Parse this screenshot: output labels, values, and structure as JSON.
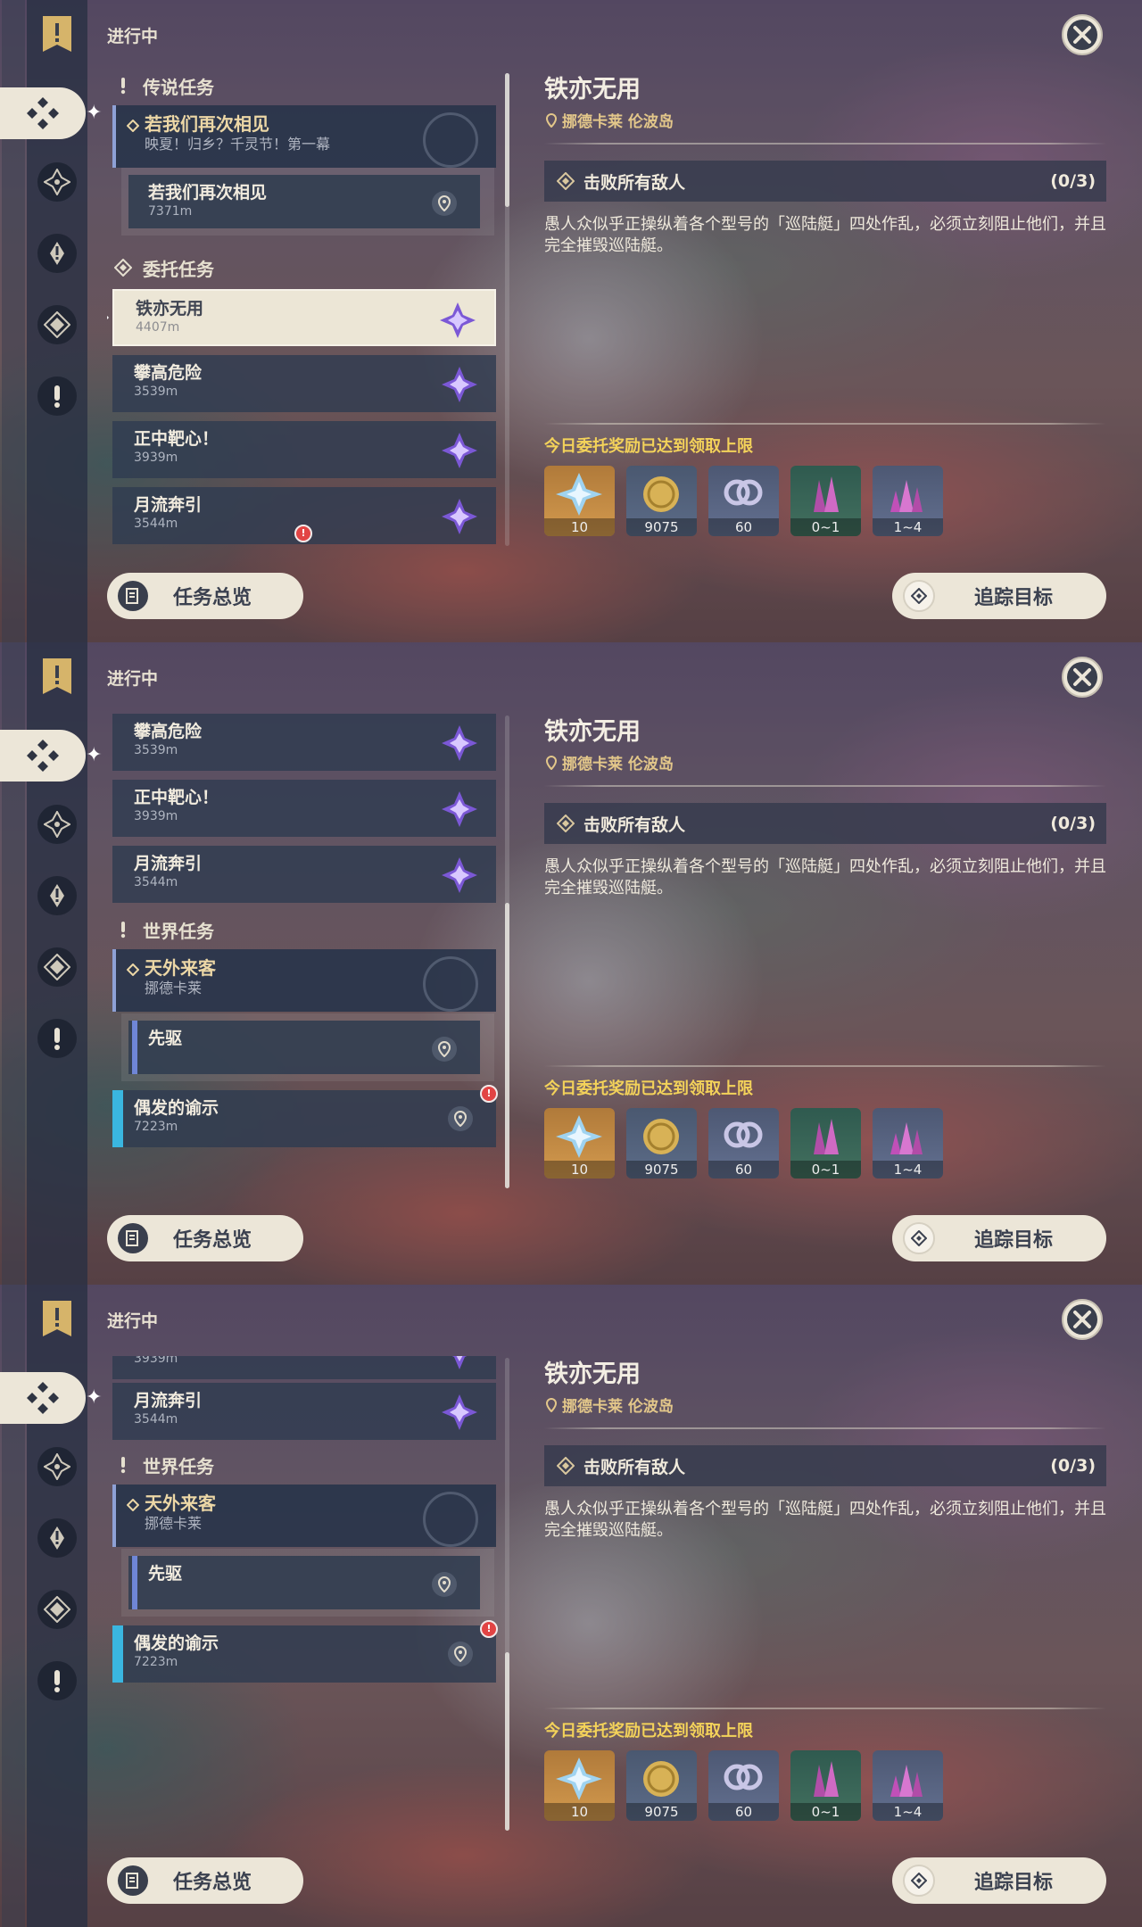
{
  "header": {
    "in_progress": "进行中"
  },
  "sections": {
    "legend": "传说任务",
    "commission": "委托任务",
    "world": "世界任务"
  },
  "quests": {
    "legend_title": "若我们再次相见",
    "legend_sub": "映夏！归乡？千灵节！第一幕",
    "legend_step_title": "若我们再次相见",
    "legend_step_dist": "7371m",
    "c1_title": "铁亦无用",
    "c1_dist": "4407m",
    "c2_title": "攀高危险",
    "c2_dist": "3539m",
    "c3_title": "正中靶心！",
    "c3_dist": "3939m",
    "c4_title": "月流奔引",
    "c4_dist": "3544m",
    "world_title": "天外来客",
    "world_sub": "挪德卡莱",
    "world_step_title": "先驱",
    "event_title": "偶发的谕示",
    "event_dist": "7223m"
  },
  "detail": {
    "title": "铁亦无用",
    "location": "挪德卡莱 伦波岛",
    "objective": "击败所有敌人",
    "objective_count": "(0/3)",
    "description": "愚人众似乎正操纵着各个型号的「巡陆艇」四处作乱，必须立刻阻止他们，并且完全摧毁巡陆艇。",
    "reward_limit": "今日委托奖励已达到领取上限",
    "rewards": [
      {
        "icon": "primogem-icon",
        "amount": "10"
      },
      {
        "icon": "mora-icon",
        "amount": "9075"
      },
      {
        "icon": "adventure-exp-icon",
        "amount": "60"
      },
      {
        "icon": "crystal-chunk-icon",
        "amount": "0~1"
      },
      {
        "icon": "crystal-cluster-icon",
        "amount": "1~4"
      }
    ]
  },
  "buttons": {
    "overview": "任务总览",
    "track": "追踪目标"
  },
  "colors": {
    "accent_gold": "#e3c78a",
    "limit_yellow": "#f3d25a",
    "button_bg": "#ece6d8",
    "event_blue": "#3ab6e0"
  },
  "icons": {
    "rail": [
      "quest-book-icon",
      "all-quests-icon",
      "archon-quest-icon",
      "story-quest-icon",
      "commission-icon",
      "world-quest-icon"
    ],
    "close": "close-icon"
  }
}
